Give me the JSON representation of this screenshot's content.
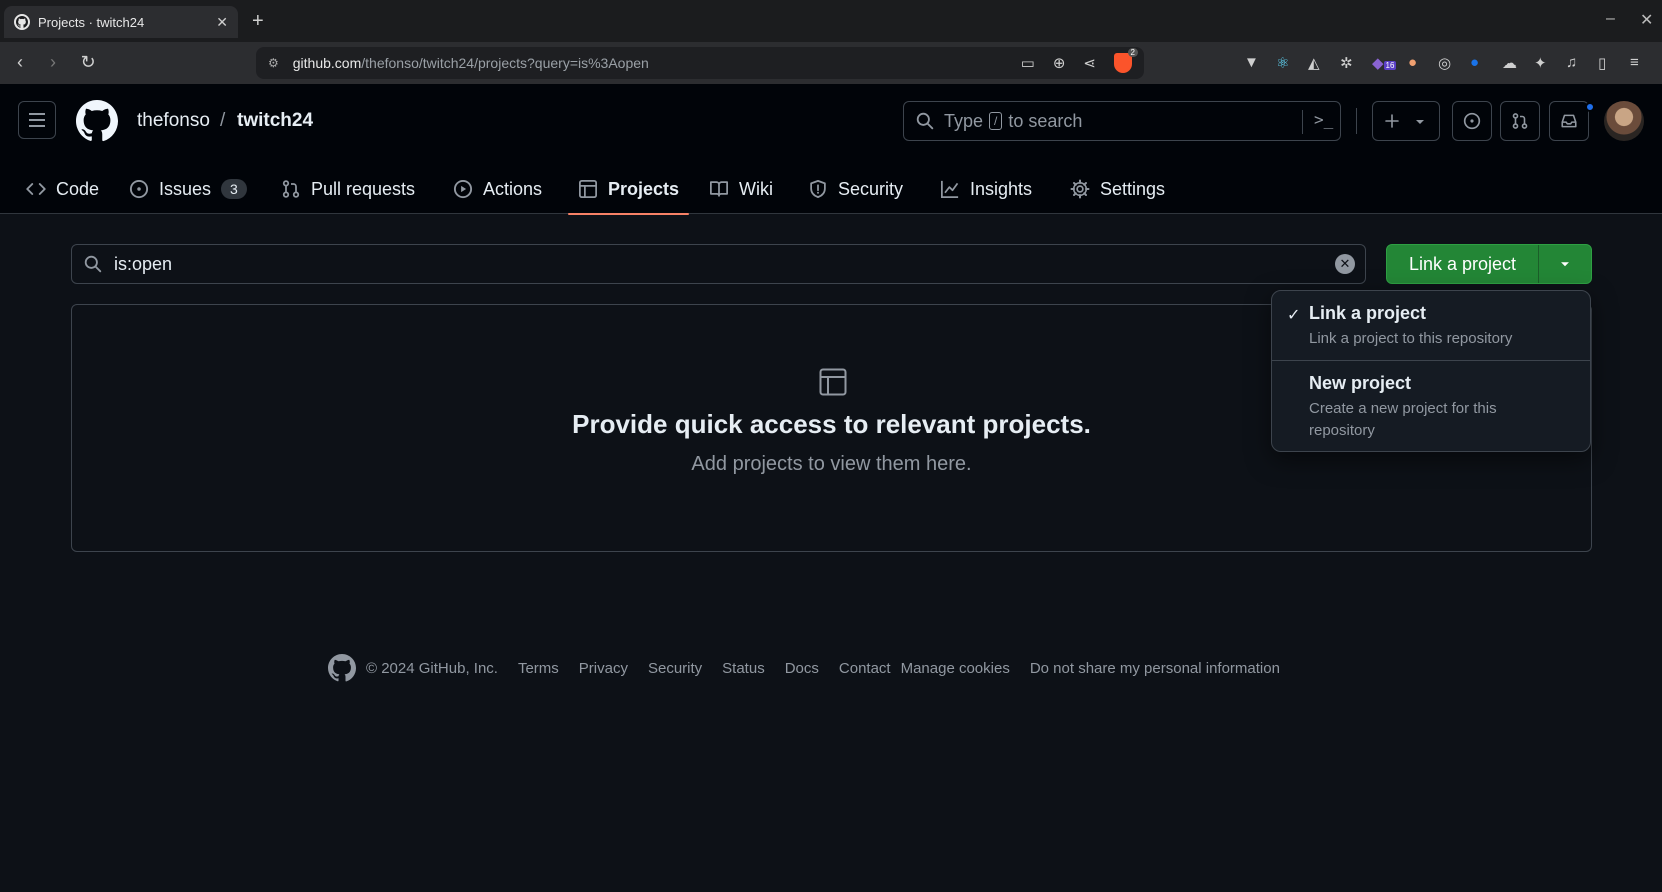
{
  "browser": {
    "tab_title": "Projects · twitch24",
    "url_host": "github.com",
    "url_path": "/thefonso/twitch24/projects?query=is%3Aopen",
    "brave_count": "2",
    "ext_badge": "16"
  },
  "header": {
    "owner": "thefonso",
    "separator": "/",
    "repo": "twitch24",
    "search_placeholder_pre": "Type",
    "search_key": "/",
    "search_placeholder_post": "to search"
  },
  "repo_nav": {
    "items": [
      {
        "label": "Code",
        "icon": "code-icon"
      },
      {
        "label": "Issues",
        "icon": "issue-icon",
        "count": "3"
      },
      {
        "label": "Pull requests",
        "icon": "pull-request-icon"
      },
      {
        "label": "Actions",
        "icon": "play-icon"
      },
      {
        "label": "Projects",
        "icon": "table-icon",
        "active": true
      },
      {
        "label": "Wiki",
        "icon": "book-icon"
      },
      {
        "label": "Security",
        "icon": "shield-icon"
      },
      {
        "label": "Insights",
        "icon": "graph-icon"
      },
      {
        "label": "Settings",
        "icon": "gear-icon"
      }
    ]
  },
  "filter": {
    "value": "is:open"
  },
  "link_button": {
    "label": "Link a project"
  },
  "dropdown": {
    "items": [
      {
        "title": "Link a project",
        "description": "Link a project to this repository",
        "checked": true
      },
      {
        "title": "New project",
        "description": "Create a new project for this repository",
        "checked": false
      }
    ]
  },
  "blankslate": {
    "heading": "Provide quick access to relevant projects.",
    "text": "Add projects to view them here."
  },
  "footer": {
    "copyright": "© 2024 GitHub, Inc.",
    "links": [
      "Terms",
      "Privacy",
      "Security",
      "Status",
      "Docs",
      "Contact",
      "Manage cookies",
      "Do not share my personal information"
    ]
  },
  "colors": {
    "accent_green": "#238636",
    "tab_underline": "#f78166",
    "notification": "#1f6feb",
    "background": "#0d1117"
  }
}
